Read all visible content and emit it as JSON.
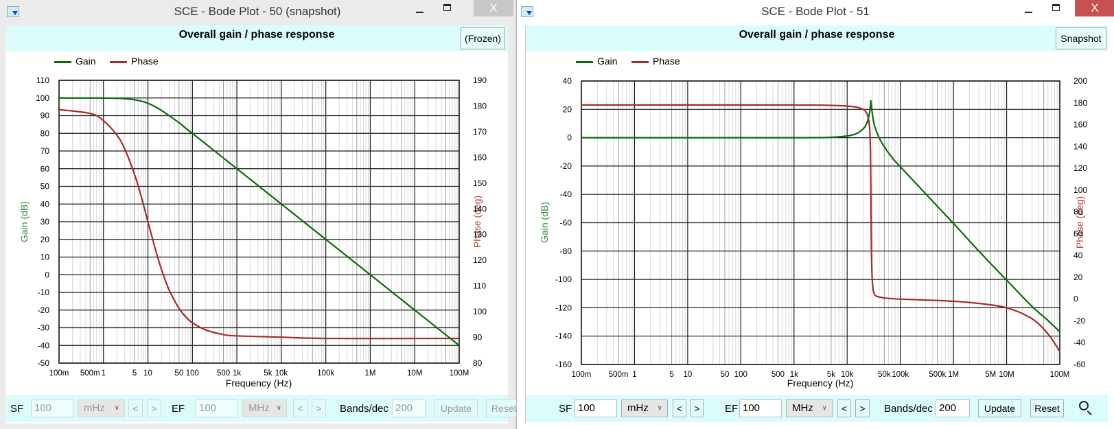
{
  "windows": [
    {
      "title": "SCE - Bode Plot - 50  (snapshot)",
      "header_title": "Overall gain / phase response",
      "header_button": "(Frozen)",
      "legend": {
        "gain": "Gain",
        "phase": "Phase"
      },
      "controls": {
        "sf_label": "SF",
        "sf_value": "100",
        "sf_unit": "mHz",
        "ef_label": "EF",
        "ef_value": "100",
        "ef_unit": "MHz",
        "prev": "<",
        "next": ">",
        "bands_label": "Bands/dec",
        "bands_value": "200",
        "update": "Update",
        "reset": "Reset",
        "enabled": false
      }
    },
    {
      "title": "SCE - Bode Plot - 51",
      "header_title": "Overall gain / phase response",
      "header_button": "Snapshot",
      "legend": {
        "gain": "Gain",
        "phase": "Phase"
      },
      "controls": {
        "sf_label": "SF",
        "sf_value": "100",
        "sf_unit": "mHz",
        "ef_label": "EF",
        "ef_value": "100",
        "ef_unit": "MHz",
        "prev": "<",
        "next": ">",
        "bands_label": "Bands/dec",
        "bands_value": "200",
        "update": "Update",
        "reset": "Reset",
        "enabled": true
      }
    }
  ],
  "colors": {
    "gain": "#0b6b0b",
    "phase": "#a82a2a",
    "header_bg": "#dcfcfc"
  },
  "icons": {
    "app": "sce-app-icon",
    "zoom": "magnifier-icon",
    "minimize": "minimize-icon",
    "maximize": "maximize-icon",
    "close": "close-icon"
  },
  "chart_data": [
    {
      "type": "line",
      "xlabel": "Frequency (Hz)",
      "ylabel": "Gain (dB)",
      "y2label": "Phase (deg)",
      "x_scale": "log",
      "xlim": [
        0.1,
        100000000
      ],
      "ylim": [
        -50,
        110
      ],
      "y2lim": [
        80,
        190
      ],
      "grid": true,
      "legend": "top-left",
      "x_ticks": [
        {
          "value": 0.1,
          "label": "100m"
        },
        {
          "value": 0.5,
          "label": "500m"
        },
        {
          "value": 1,
          "label": "1"
        },
        {
          "value": 5,
          "label": "5"
        },
        {
          "value": 10,
          "label": "10"
        },
        {
          "value": 50,
          "label": "50"
        },
        {
          "value": 100,
          "label": "100"
        },
        {
          "value": 500,
          "label": "500"
        },
        {
          "value": 1000,
          "label": "1k"
        },
        {
          "value": 5000,
          "label": "5k"
        },
        {
          "value": 10000,
          "label": "10k"
        },
        {
          "value": 100000,
          "label": "100k"
        },
        {
          "value": 1000000,
          "label": "1M"
        },
        {
          "value": 10000000,
          "label": "10M"
        },
        {
          "value": 100000000,
          "label": "100M"
        }
      ],
      "y_ticks": [
        110,
        100,
        90,
        80,
        70,
        60,
        50,
        40,
        30,
        20,
        10,
        0,
        -10,
        -20,
        -30,
        -40,
        -50
      ],
      "y2_ticks": [
        190,
        180,
        170,
        160,
        150,
        140,
        130,
        120,
        110,
        100,
        90,
        80
      ],
      "series": [
        {
          "name": "Gain",
          "axis": "y",
          "points": [
            [
              0.1,
              100
            ],
            [
              0.5,
              99.99
            ],
            [
              1,
              99.96
            ],
            [
              2,
              99.83
            ],
            [
              3,
              99.62
            ],
            [
              5,
              99.03
            ],
            [
              7,
              98.26
            ],
            [
              10,
              96.99
            ],
            [
              15,
              94.9
            ],
            [
              20,
              93.0
            ],
            [
              30,
              90.0
            ],
            [
              50,
              86.0
            ],
            [
              70,
              83.0
            ],
            [
              100,
              79.96
            ],
            [
              200,
              74.0
            ],
            [
              500,
              66.0
            ],
            [
              1000,
              60
            ],
            [
              10000,
              40
            ],
            [
              100000,
              20
            ],
            [
              1000000,
              0
            ],
            [
              10000000,
              -20
            ],
            [
              100000000,
              -40
            ]
          ]
        },
        {
          "name": "Phase",
          "axis": "y2",
          "points": [
            [
              0.1,
              178.6
            ],
            [
              0.5,
              177.1
            ],
            [
              1,
              174.3
            ],
            [
              2,
              168.7
            ],
            [
              3,
              163.3
            ],
            [
              5,
              153.4
            ],
            [
              7,
              145.0
            ],
            [
              10,
              135
            ],
            [
              15,
              123.7
            ],
            [
              20,
              116.6
            ],
            [
              30,
              108.4
            ],
            [
              50,
              101.3
            ],
            [
              70,
              98.1
            ],
            [
              100,
              95.7
            ],
            [
              200,
              92.9
            ],
            [
              500,
              91.1
            ],
            [
              1000,
              90.6
            ],
            [
              10000,
              90.1
            ],
            [
              100000,
              89.6
            ],
            [
              100000000,
              89.6
            ]
          ]
        }
      ]
    },
    {
      "type": "line",
      "xlabel": "Frequency (Hz)",
      "ylabel": "Gain (dB)",
      "y2label": "Phase (deg)",
      "x_scale": "log",
      "xlim": [
        0.1,
        100000000
      ],
      "ylim": [
        -160,
        40
      ],
      "y2lim": [
        -60,
        200
      ],
      "grid": true,
      "legend": "top-left",
      "x_ticks": [
        {
          "value": 0.1,
          "label": "100m"
        },
        {
          "value": 0.5,
          "label": "500m"
        },
        {
          "value": 1,
          "label": "1"
        },
        {
          "value": 5,
          "label": "5"
        },
        {
          "value": 10,
          "label": "10"
        },
        {
          "value": 50,
          "label": "50"
        },
        {
          "value": 100,
          "label": "100"
        },
        {
          "value": 500,
          "label": "500"
        },
        {
          "value": 1000,
          "label": "1k"
        },
        {
          "value": 5000,
          "label": "5k"
        },
        {
          "value": 10000,
          "label": "10k"
        },
        {
          "value": 50000,
          "label": "50k"
        },
        {
          "value": 100000,
          "label": "100k"
        },
        {
          "value": 500000,
          "label": "500k"
        },
        {
          "value": 1000000,
          "label": "1M"
        },
        {
          "value": 5000000,
          "label": "5M"
        },
        {
          "value": 10000000,
          "label": "10M"
        },
        {
          "value": 100000000,
          "label": "100M"
        }
      ],
      "y_ticks": [
        40,
        20,
        0,
        -20,
        -40,
        -60,
        -80,
        -100,
        -120,
        -140,
        -160
      ],
      "y2_ticks": [
        200,
        180,
        160,
        140,
        120,
        100,
        80,
        60,
        40,
        20,
        0,
        -20,
        -40,
        -60
      ],
      "series": [
        {
          "name": "Gain",
          "axis": "y",
          "points": [
            [
              0.1,
              0
            ],
            [
              1000,
              0
            ],
            [
              5000,
              0.3
            ],
            [
              10000,
              1.2
            ],
            [
              15000,
              2.9
            ],
            [
              20000,
              6.2
            ],
            [
              23000,
              9.5
            ],
            [
              25000,
              13.6
            ],
            [
              26500,
              18
            ],
            [
              27500,
              23
            ],
            [
              28000,
              26
            ],
            [
              28500,
              23
            ],
            [
              29500,
              18
            ],
            [
              31000,
              12.7
            ],
            [
              33000,
              8
            ],
            [
              36000,
              4
            ],
            [
              40000,
              0
            ],
            [
              50000,
              -6.5
            ],
            [
              70000,
              -14
            ],
            [
              100000,
              -20.5
            ],
            [
              1000000,
              -60.5
            ],
            [
              3000000,
              -80
            ],
            [
              10000000,
              -100.5
            ],
            [
              30000000,
              -119
            ],
            [
              60000000,
              -129
            ],
            [
              100000000,
              -137
            ]
          ]
        },
        {
          "name": "Phase",
          "axis": "y2",
          "points": [
            [
              0.1,
              178
            ],
            [
              1000,
              178
            ],
            [
              5000,
              177.6
            ],
            [
              10000,
              177
            ],
            [
              15000,
              176
            ],
            [
              20000,
              174
            ],
            [
              23000,
              171
            ],
            [
              25000,
              166
            ],
            [
              26500,
              157
            ],
            [
              27500,
              135
            ],
            [
              28000,
              95
            ],
            [
              28500,
              50
            ],
            [
              29500,
              20
            ],
            [
              31000,
              8
            ],
            [
              33000,
              4
            ],
            [
              36000,
              2.5
            ],
            [
              50000,
              1
            ],
            [
              100000,
              0
            ],
            [
              1000000,
              -2
            ],
            [
              3000000,
              -4
            ],
            [
              10000000,
              -8
            ],
            [
              30000000,
              -18
            ],
            [
              60000000,
              -32
            ],
            [
              100000000,
              -48
            ]
          ]
        }
      ]
    }
  ]
}
